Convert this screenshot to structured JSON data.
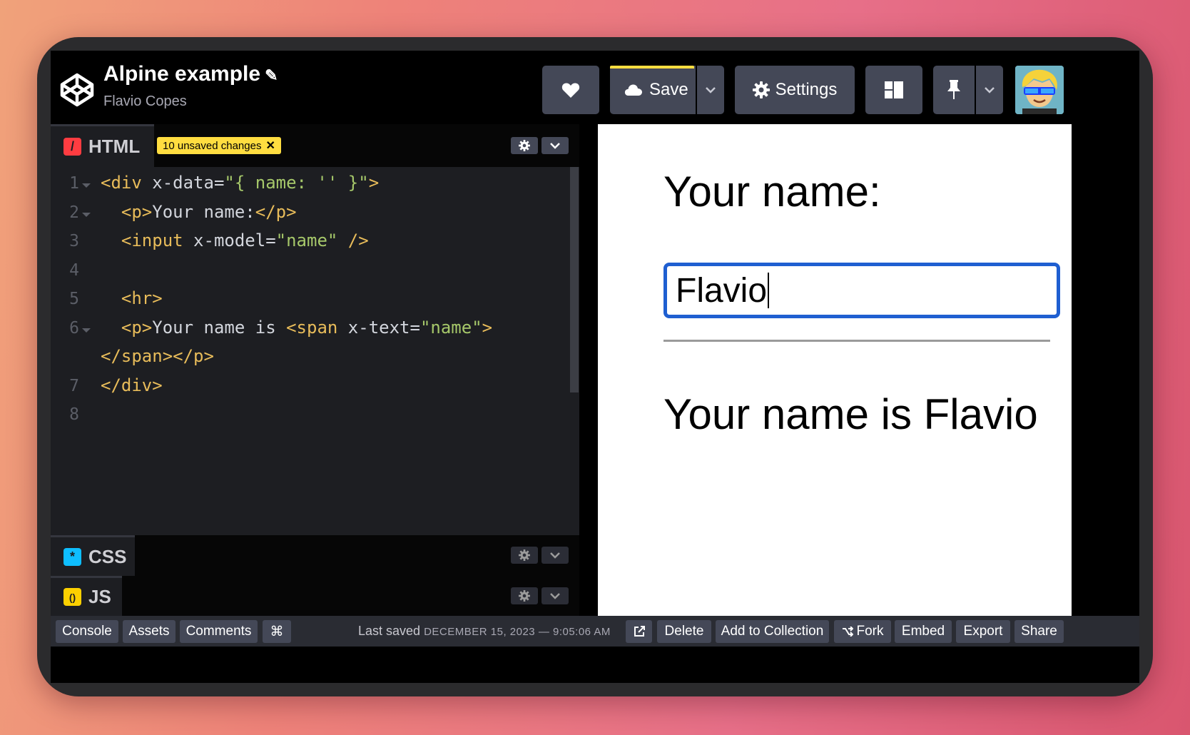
{
  "pen": {
    "title": "Alpine example",
    "author": "Flavio Copes"
  },
  "header": {
    "save_label": "Save",
    "settings_label": "Settings"
  },
  "editors": {
    "html": {
      "label": "HTML",
      "icon_text": "/",
      "color": "#ff3c41",
      "unsaved_badge": "10 unsaved changes",
      "badge_close": "✕"
    },
    "css": {
      "label": "CSS",
      "icon_text": "*",
      "color": "#0ebeff"
    },
    "js": {
      "label": "JS",
      "icon_text": "()",
      "color": "#fcd000"
    }
  },
  "code_lines": [
    {
      "num": "1",
      "fold": true
    },
    {
      "num": "2",
      "fold": true
    },
    {
      "num": "3",
      "fold": false
    },
    {
      "num": "4",
      "fold": false
    },
    {
      "num": "5",
      "fold": false
    },
    {
      "num": "6",
      "fold": true
    },
    {
      "num": "",
      "fold": false
    },
    {
      "num": "7",
      "fold": false
    },
    {
      "num": "8",
      "fold": false
    }
  ],
  "code": {
    "l1_open": "<div",
    "l1_attr": " x-data=",
    "l1_val": "\"{ name: '' }\"",
    "l1_close": ">",
    "l2_open": "<p>",
    "l2_text": "Your name:",
    "l2_close": "</p>",
    "l3_open": "<input",
    "l3_attr": " x-model=",
    "l3_val": "\"name\"",
    "l3_close": " />",
    "l5_tag": "<hr>",
    "l6_open": "<p>",
    "l6_text": "Your name is ",
    "l6_span": "<span",
    "l6_attr": " x-text=",
    "l6_val": "\"name\"",
    "l6_close": ">",
    "l6b": "</span></p>",
    "l7": "</div>"
  },
  "preview": {
    "label": "Your name:",
    "input_value": "Flavio",
    "output": "Your name is Flavio"
  },
  "footer": {
    "console": "Console",
    "assets": "Assets",
    "comments": "Comments",
    "shortcuts": "⌘",
    "last_saved_label": "Last saved",
    "last_saved_time": "DECEMBER 15, 2023 — 9:05:06 AM",
    "delete": "Delete",
    "add_to_collection": "Add to Collection",
    "fork": "Fork",
    "embed": "Embed",
    "export": "Export",
    "share": "Share"
  },
  "icons": {
    "logo": "codepen-logo-icon",
    "pencil": "pencil-icon",
    "heart": "heart-icon",
    "cloud": "cloud-icon",
    "gear": "gear-icon",
    "layout": "layout-icon",
    "pin": "pin-icon",
    "chevron": "chevron-down-icon",
    "external": "external-link-icon",
    "fork": "fork-icon"
  },
  "colors": {
    "accent_yellow": "#ffdd40",
    "button_bg": "#444857",
    "input_border": "#1f5fd1"
  }
}
